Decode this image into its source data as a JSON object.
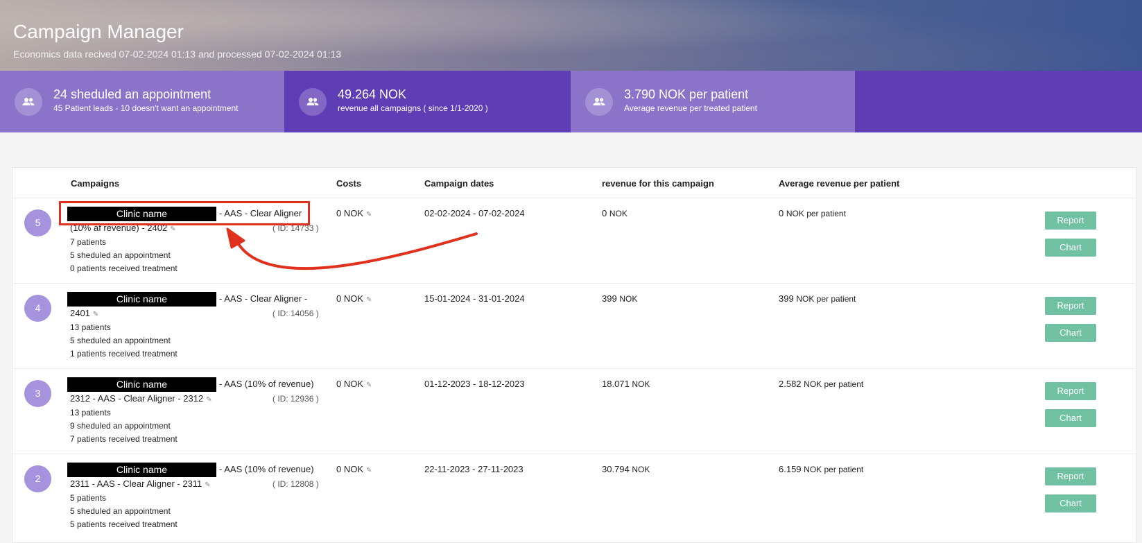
{
  "header": {
    "title": "Campaign Manager",
    "subtitle": "Economics data recived 07-02-2024 01:13 and processed 07-02-2024 01:13"
  },
  "stats": [
    {
      "icon": "people-icon",
      "title": "24 sheduled an appointment",
      "subtitle": "45 Patient leads - 10 doesn't want an appointment"
    },
    {
      "icon": "people-icon",
      "title": "49.264 NOK",
      "subtitle": "revenue all campaigns ( since 1/1-2020 )"
    },
    {
      "icon": "people-icon",
      "title": "3.790 NOK per patient",
      "subtitle": "Average revenue per treated patient"
    }
  ],
  "table": {
    "headers": {
      "campaigns": "Campaigns",
      "costs": "Costs",
      "dates": "Campaign dates",
      "revenue": "revenue for this campaign",
      "average": "Average revenue per patient"
    },
    "rows": [
      {
        "number": "5",
        "clinic": "Clinic name",
        "name_line1": "- AAS - Clear Aligner",
        "name_line2": "(10% af revenue) - 2402",
        "id": "( ID: 14733 )",
        "patients": "7 patients",
        "scheduled": "5 sheduled an appointment",
        "treated": "0 patients received treatment",
        "cost": "0 NOK",
        "dates": "02-02-2024 - 07-02-2024",
        "revenue": "0",
        "revenue_unit": "NOK",
        "avg": "0",
        "avg_unit": "NOK per patient",
        "report_label": "Report",
        "chart_label": "Chart"
      },
      {
        "number": "4",
        "clinic": "Clinic name",
        "name_line1": "- AAS - Clear Aligner -",
        "name_line2": "2401",
        "id": "( ID: 14056 )",
        "patients": "13 patients",
        "scheduled": "5 sheduled an appointment",
        "treated": "1 patients received treatment",
        "cost": "0 NOK",
        "dates": "15-01-2024 - 31-01-2024",
        "revenue": "399",
        "revenue_unit": "NOK",
        "avg": "399",
        "avg_unit": "NOK per patient",
        "report_label": "Report",
        "chart_label": "Chart"
      },
      {
        "number": "3",
        "clinic": "Clinic name",
        "name_line1": "- AAS (10% of revenue)",
        "name_line2": "2312 - AAS - Clear Aligner - 2312",
        "id": "( ID: 12936 )",
        "patients": "13 patients",
        "scheduled": "9 sheduled an appointment",
        "treated": "7 patients received treatment",
        "cost": "0 NOK",
        "dates": "01-12-2023 - 18-12-2023",
        "revenue": "18.071",
        "revenue_unit": "NOK",
        "avg": "2.582",
        "avg_unit": "NOK per patient",
        "report_label": "Report",
        "chart_label": "Chart"
      },
      {
        "number": "2",
        "clinic": "Clinic name",
        "name_line1": "- AAS (10% of revenue)",
        "name_line2": "2311 - AAS - Clear Aligner - 2311",
        "id": "( ID: 12808 )",
        "patients": "5 patients",
        "scheduled": "5 sheduled an appointment",
        "treated": "5 patients received treatment",
        "cost": "0 NOK",
        "dates": "22-11-2023 - 27-11-2023",
        "revenue": "30.794",
        "revenue_unit": "NOK",
        "avg": "6.159",
        "avg_unit": "NOK per patient",
        "report_label": "Report",
        "chart_label": "Chart"
      }
    ]
  },
  "colors": {
    "stat_light": "#8a73c9",
    "stat_dark": "#5f3db4",
    "button": "#70c1a2",
    "annotation": "#e0301e"
  }
}
